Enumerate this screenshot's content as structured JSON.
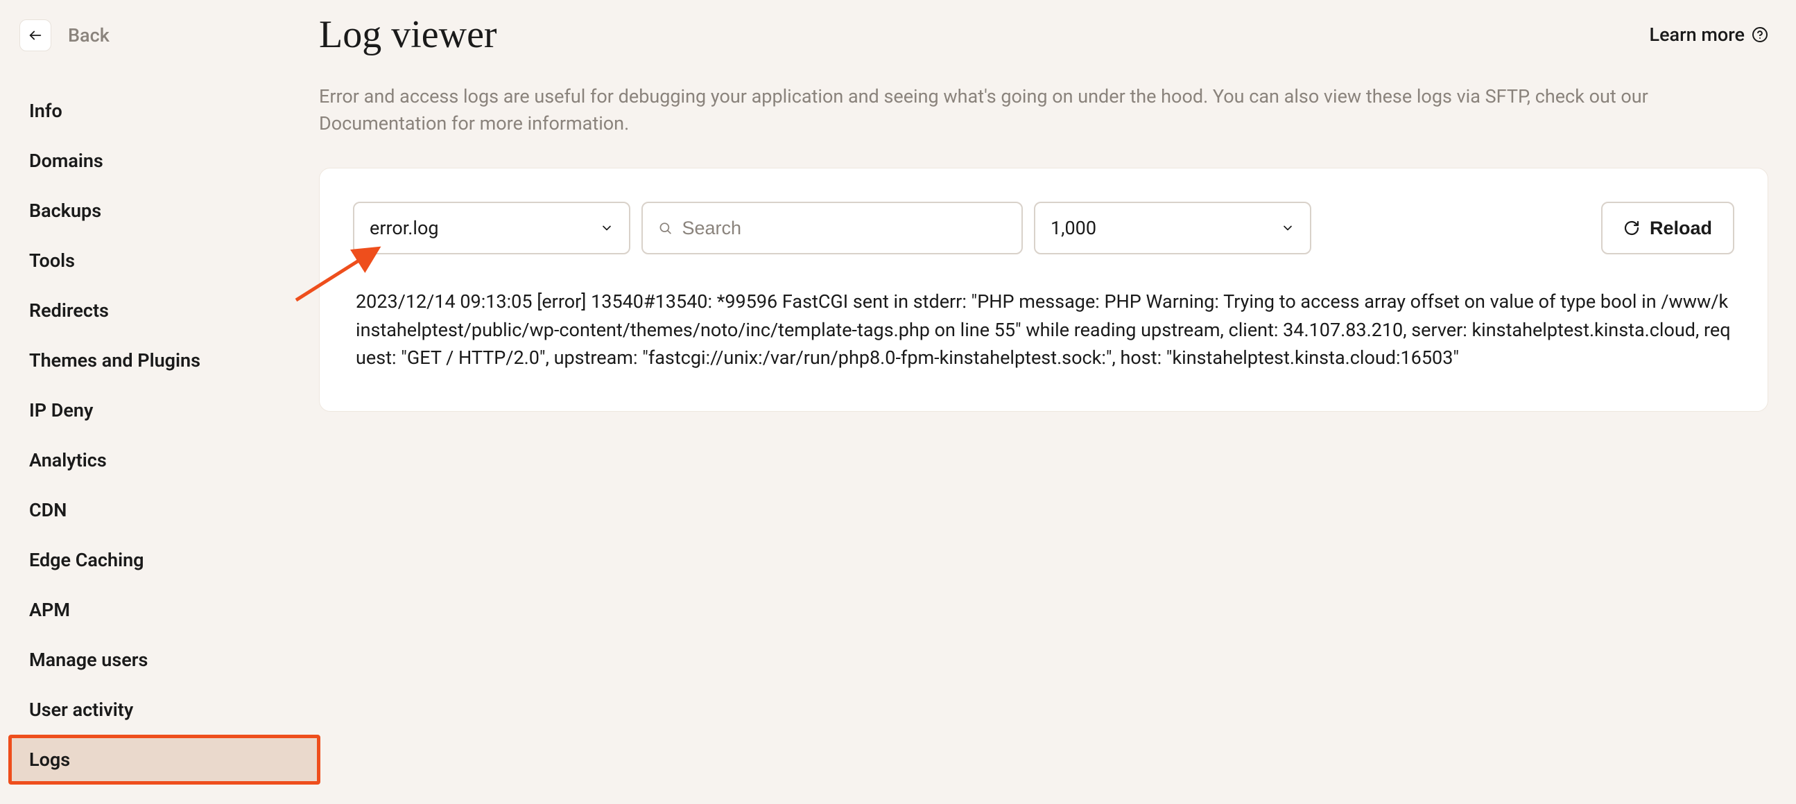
{
  "sidebar": {
    "back_label": "Back",
    "items": [
      {
        "label": "Info"
      },
      {
        "label": "Domains"
      },
      {
        "label": "Backups"
      },
      {
        "label": "Tools"
      },
      {
        "label": "Redirects"
      },
      {
        "label": "Themes and Plugins"
      },
      {
        "label": "IP Deny"
      },
      {
        "label": "Analytics"
      },
      {
        "label": "CDN"
      },
      {
        "label": "Edge Caching"
      },
      {
        "label": "APM"
      },
      {
        "label": "Manage users"
      },
      {
        "label": "User activity"
      },
      {
        "label": "Logs",
        "active": true
      }
    ]
  },
  "header": {
    "title": "Log viewer",
    "learn_more": "Learn more"
  },
  "description": "Error and access logs are useful for debugging your application and seeing what's going on under the hood. You can also view these logs via SFTP, check out our Documentation for more information.",
  "controls": {
    "log_file": "error.log",
    "search_placeholder": "Search",
    "count": "1,000",
    "reload_label": "Reload"
  },
  "log": {
    "entries": [
      "2023/12/14 09:13:05 [error] 13540#13540: *99596 FastCGI sent in stderr: \"PHP message: PHP Warning: Trying to access array offset on value of type bool in /www/kinstahelptest/public/wp-content/themes/noto/inc/template-tags.php on line 55\" while reading upstream, client: 34.107.83.210, server: kinstahelptest.kinsta.cloud, request: \"GET / HTTP/2.0\", upstream: \"fastcgi://unix:/var/run/php8.0-fpm-kinstahelptest.sock:\", host: \"kinstahelptest.kinsta.cloud:16503\""
    ]
  }
}
